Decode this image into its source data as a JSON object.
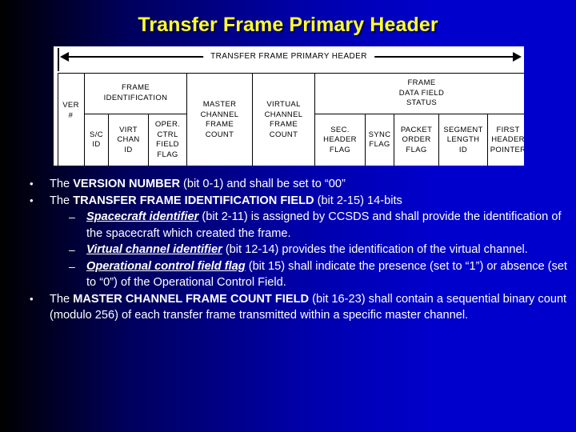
{
  "slide": {
    "title": "Transfer Frame Primary Header",
    "title_color": "#ffff33",
    "background_from": "#000000",
    "background_to": "#0000cc"
  },
  "diagram": {
    "span_label": "TRANSFER FRAME PRIMARY HEADER",
    "group_row": [
      {
        "label": "",
        "name": "version-group-spacer"
      },
      {
        "label": "FRAME\nIDENTIFICATION",
        "name": "frame-identification-group"
      },
      {
        "label": "MASTER\nCHANNEL\nFRAME\nCOUNT",
        "name": "master-channel-frame-count-group"
      },
      {
        "label": "VIRTUAL\nCHANNEL\nFRAME\nCOUNT",
        "name": "virtual-channel-frame-count-group"
      },
      {
        "label": "FRAME\nDATA FIELD\nSTATUS",
        "name": "frame-data-field-status-group"
      }
    ],
    "field_row": [
      {
        "label": "VER\n#",
        "name": "field-version-number"
      },
      {
        "label": "S/C\nID",
        "name": "field-spacecraft-id"
      },
      {
        "label": "VIRT\nCHAN\nID",
        "name": "field-virtual-channel-id"
      },
      {
        "label": "OPER.\nCTRL\nFIELD\nFLAG",
        "name": "field-operational-control-field-flag"
      },
      {
        "label": "SEC.\nHEADER\nFLAG",
        "name": "field-sec-header-flag"
      },
      {
        "label": "SYNC\nFLAG",
        "name": "field-sync-flag"
      },
      {
        "label": "PACKET\nORDER\nFLAG",
        "name": "field-packet-order-flag"
      },
      {
        "label": "SEGMENT\nLENGTH\nID",
        "name": "field-segment-length-id"
      },
      {
        "label": "FIRST\nHEADER\nPOINTER",
        "name": "field-first-header-pointer"
      }
    ]
  },
  "bullets": {
    "marker_level1": "•",
    "marker_level2": "–",
    "items": [
      {
        "level": 1,
        "name": "bullet-version-number",
        "runs": [
          {
            "text": "The ",
            "style": "plain"
          },
          {
            "text": "VERSION NUMBER",
            "style": "bold"
          },
          {
            "text": " (bit 0-1) and shall be set to “00”",
            "style": "plain"
          }
        ]
      },
      {
        "level": 1,
        "name": "bullet-transfer-frame-identification-field",
        "runs": [
          {
            "text": "The ",
            "style": "plain"
          },
          {
            "text": "TRANSFER FRAME IDENTIFICATION FIELD",
            "style": "bold"
          },
          {
            "text": " (bit 2-15) 14-bits",
            "style": "plain"
          }
        ]
      },
      {
        "level": 2,
        "name": "bullet-spacecraft-identifier",
        "runs": [
          {
            "text": "Spacecraft identifier",
            "style": "emph"
          },
          {
            "text": " (bit 2-11) is assigned by CCSDS and shall provide the identification of the spacecraft which created the frame.",
            "style": "plain"
          }
        ]
      },
      {
        "level": 2,
        "name": "bullet-virtual-channel-identifier",
        "runs": [
          {
            "text": "Virtual channel identifier",
            "style": "emph"
          },
          {
            "text": " (bit 12-14) provides the identification of the virtual channel.",
            "style": "plain"
          }
        ]
      },
      {
        "level": 2,
        "name": "bullet-operational-control-field-flag",
        "runs": [
          {
            "text": " Operational control field flag",
            "style": "emph"
          },
          {
            "text": " (bit 15) shall indicate the presence (set to “1”) or absence (set to “0”) of the Operational Control Field.",
            "style": "plain"
          }
        ]
      },
      {
        "level": 1,
        "name": "bullet-master-channel-frame-count-field",
        "runs": [
          {
            "text": "The ",
            "style": "plain"
          },
          {
            "text": "MASTER CHANNEL FRAME COUNT FIELD",
            "style": "bold"
          },
          {
            "text": " (bit 16-23) shall contain a sequential binary count (modulo 256) of each transfer frame transmitted within a specific master channel.",
            "style": "plain"
          }
        ]
      }
    ]
  }
}
